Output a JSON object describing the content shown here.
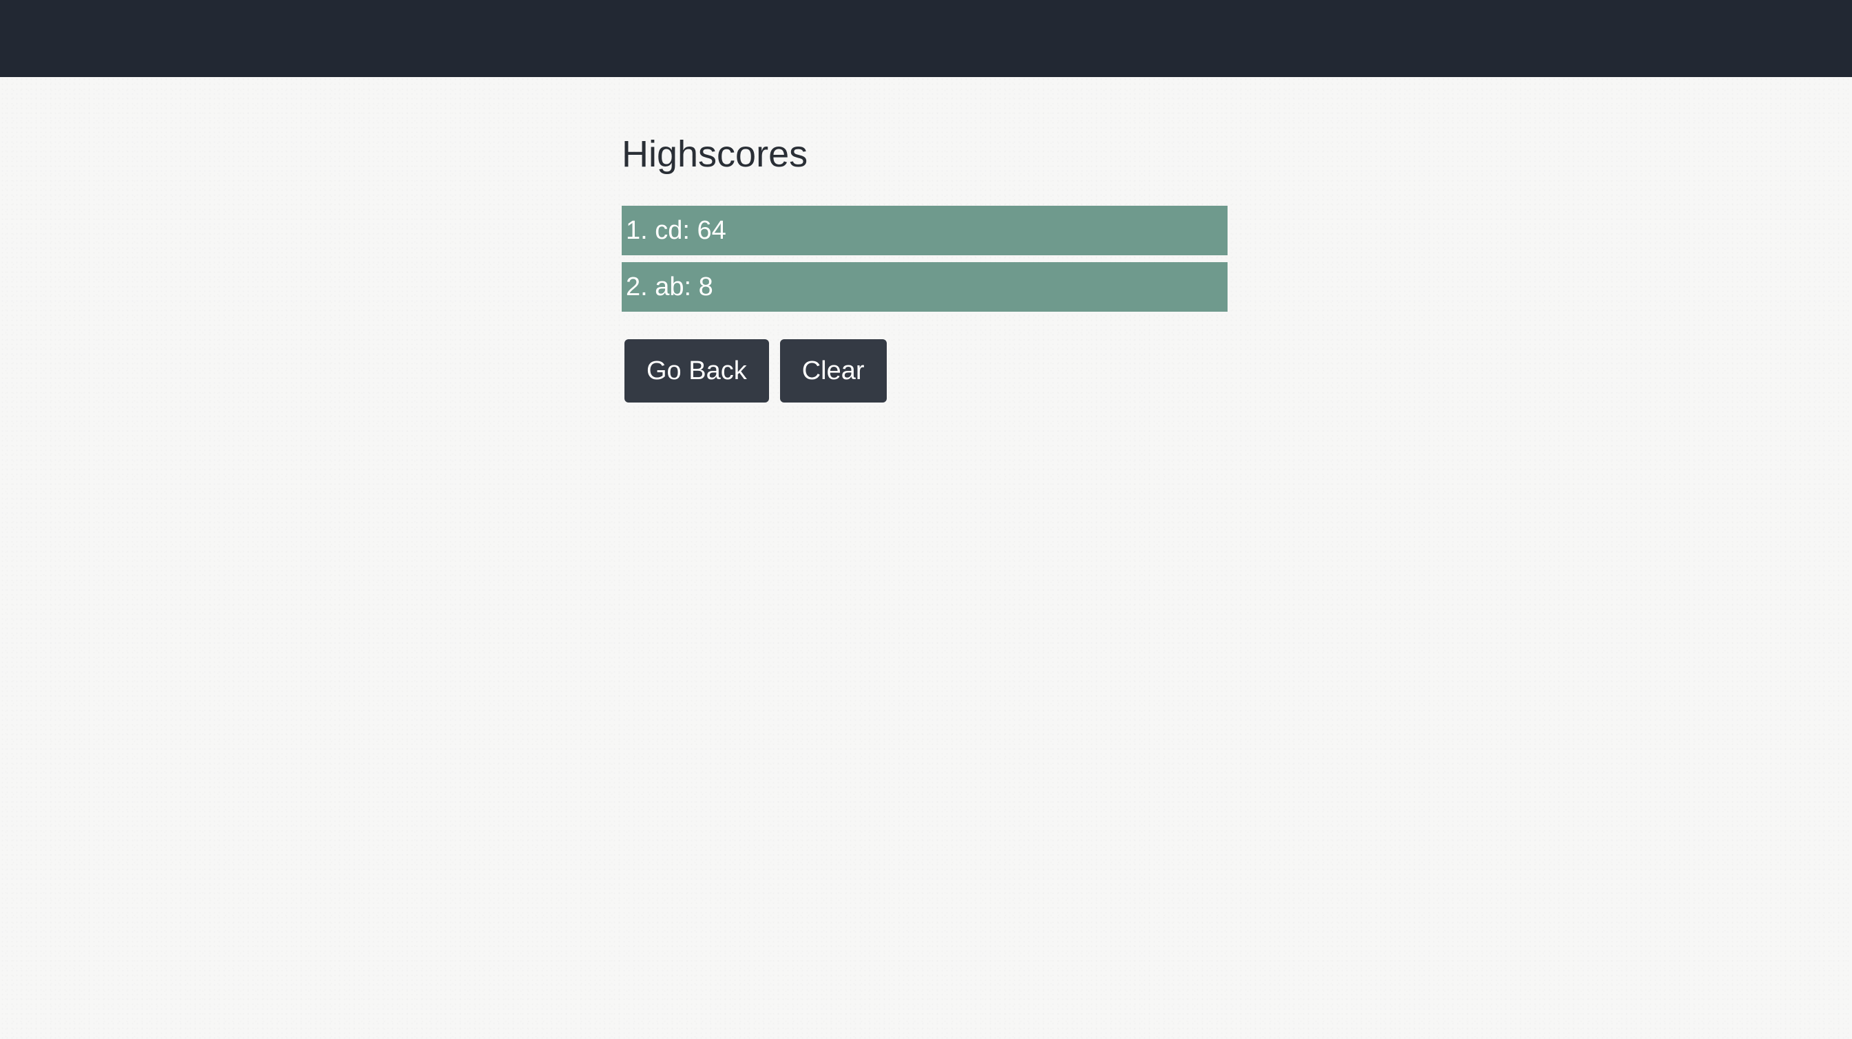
{
  "header": {
    "background_color": "#222833"
  },
  "main": {
    "title": "Highscores",
    "scores": [
      {
        "text": "1. cd: 64"
      },
      {
        "text": "2. ab: 8"
      }
    ],
    "score_item_color": "#6f9a8d",
    "buttons": {
      "go_back_label": "Go Back",
      "clear_label": "Clear"
    },
    "button_color": "#343a44"
  }
}
